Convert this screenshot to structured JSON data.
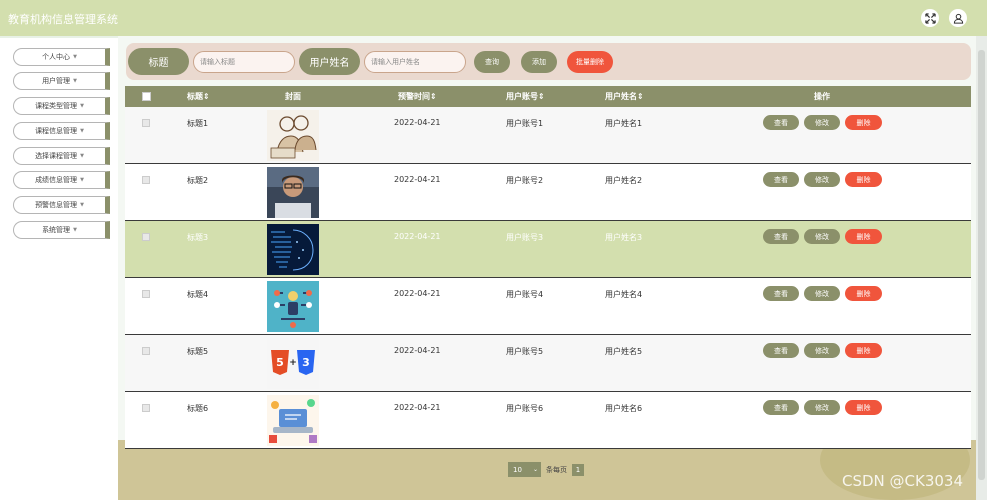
{
  "app": {
    "title": "教育机构信息管理系统"
  },
  "topbar": {
    "icons": [
      "fullscreen-icon",
      "user-icon"
    ]
  },
  "sidebar": {
    "items": [
      {
        "label": "个人中心"
      },
      {
        "label": "用户管理"
      },
      {
        "label": "课程类型管理"
      },
      {
        "label": "课程信息管理"
      },
      {
        "label": "选择课程管理"
      },
      {
        "label": "成绩信息管理"
      },
      {
        "label": "预警信息管理"
      },
      {
        "label": "系统管理"
      }
    ]
  },
  "search": {
    "title_label": "标题",
    "title_placeholder": "请输入标题",
    "name_label": "用户姓名",
    "name_placeholder": "请输入用户姓名",
    "query_button": "查询",
    "add_button": "添加",
    "batch_delete_button": "批量删除"
  },
  "table": {
    "columns": {
      "title": "标题",
      "cover": "封面",
      "warning_time": "预警时间",
      "account": "用户账号",
      "username": "用户姓名",
      "actions": "操作"
    },
    "action_labels": {
      "view": "查看",
      "edit": "修改",
      "delete": "删除"
    },
    "rows": [
      {
        "title": "标题1",
        "time": "2022-04-21",
        "account": "用户账号1",
        "name": "用户姓名1",
        "image": "people-at-laptop"
      },
      {
        "title": "标题2",
        "time": "2022-04-21",
        "account": "用户账号2",
        "name": "用户姓名2",
        "image": "child-at-laptop"
      },
      {
        "title": "标题3",
        "time": "2022-04-21",
        "account": "用户账号3",
        "name": "用户姓名3",
        "image": "digital-head"
      },
      {
        "title": "标题4",
        "time": "2022-04-21",
        "account": "用户账号4",
        "name": "用户姓名4",
        "image": "network-person"
      },
      {
        "title": "标题5",
        "time": "2022-04-21",
        "account": "用户账号5",
        "name": "用户姓名5",
        "image": "html5-css3-logos"
      },
      {
        "title": "标题6",
        "time": "2022-04-21",
        "account": "用户账号6",
        "name": "用户姓名6",
        "image": "laptop-illustration"
      }
    ],
    "highlighted_row": 3
  },
  "pagination": {
    "page_size": "10",
    "per_page_label": "条每页",
    "current_page": "1"
  },
  "watermark": "CSDN @CK3034",
  "colors": {
    "olive": "#8b906a",
    "topbar": "#d3dfae",
    "red": "#f0553c",
    "panel": "#ead9cf"
  }
}
